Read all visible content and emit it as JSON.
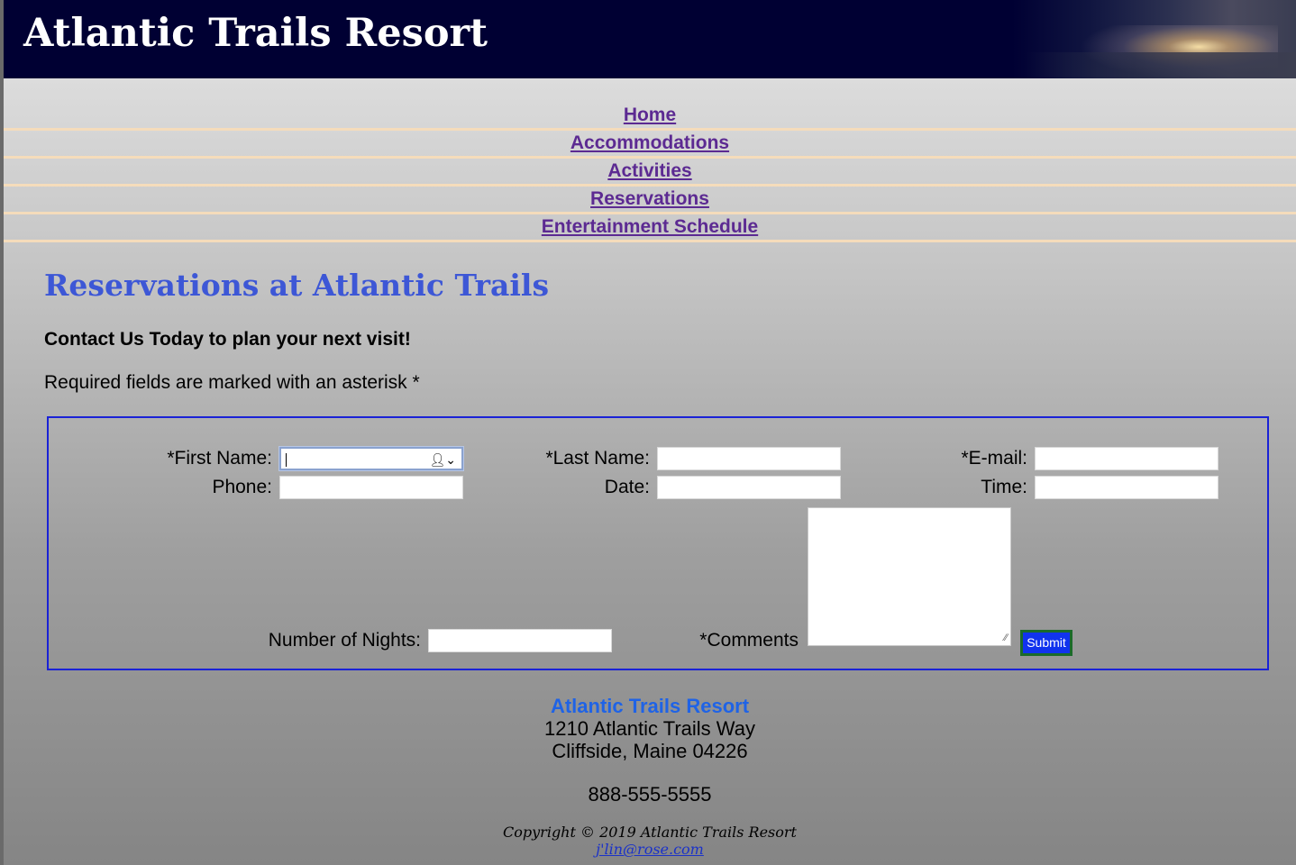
{
  "header": {
    "title": "Atlantic Trails Resort"
  },
  "nav": {
    "items": [
      {
        "label": "Home"
      },
      {
        "label": "Accommodations"
      },
      {
        "label": "Activities"
      },
      {
        "label": "Reservations"
      },
      {
        "label": "Entertainment Schedule"
      }
    ]
  },
  "main": {
    "heading": "Reservations at Atlantic Trails",
    "tagline": "Contact Us Today to plan your next visit!",
    "required_note": "Required fields are marked with an asterisk *"
  },
  "form": {
    "first_name_label": "*First Name:",
    "last_name_label": "*Last Name:",
    "email_label": "*E-mail:",
    "phone_label": "Phone:",
    "date_label": "Date:",
    "time_label": "Time:",
    "nights_label": "Number of Nights:",
    "comments_label": "*Comments",
    "submit_label": "Submit",
    "first_name_value": "",
    "last_name_value": "",
    "email_value": "",
    "phone_value": "",
    "date_value": "",
    "time_value": "",
    "nights_value": "",
    "comments_value": "",
    "autofill_icon": "contact-autofill-icon"
  },
  "footer": {
    "name": "Atlantic Trails Resort",
    "address_line1": "1210 Atlantic Trails Way",
    "address_line2": "Cliffside, Maine 04226",
    "phone": "888-555-5555",
    "copyright": "Copyright © 2019 Atlantic Trails Resort",
    "email": "j'lin@rose.com"
  },
  "colors": {
    "header_bg": "#000033",
    "nav_link": "#5c2a92",
    "nav_divider": "#f5dcbb",
    "heading": "#3d57d6",
    "form_border": "#1a22d6",
    "submit_bg": "#1133ee",
    "footer_name": "#1f63e6"
  }
}
